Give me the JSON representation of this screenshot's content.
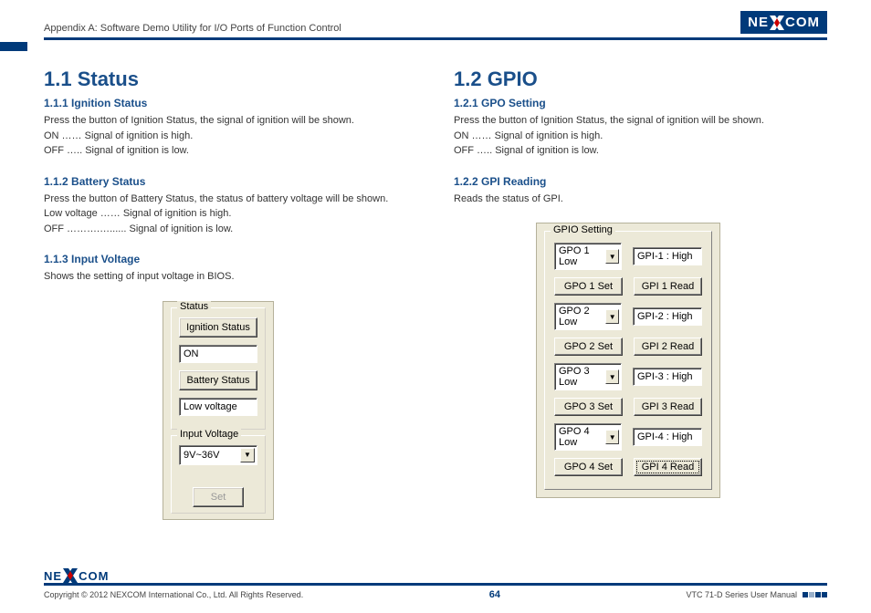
{
  "header": {
    "title": "Appendix A: Software Demo Utility for I/O Ports of Function Control",
    "brand": "NEXCOM"
  },
  "left": {
    "h1": "1.1  Status",
    "s1": {
      "h": "1.1.1  Ignition Status",
      "p": "Press the button of Ignition Status, the signal of ignition will be shown.\nON …… Signal of ignition is high.\nOFF ….. Signal of ignition is low."
    },
    "s2": {
      "h": "1.1.2  Battery Status",
      "p": "Press the button of Battery Status, the status of battery voltage will be shown.\nLow voltage …… Signal of ignition is high.\nOFF ……….…...... Signal of ignition is low."
    },
    "s3": {
      "h": "1.1.3  Input Voltage",
      "p": "Shows the setting of input voltage in BIOS."
    },
    "status_panel": {
      "legend": "Status",
      "btn_ign": "Ignition Status",
      "val_ign": "ON",
      "btn_bat": "Battery Status",
      "val_bat": "Low voltage"
    },
    "iv_panel": {
      "legend": "Input Voltage",
      "dd": "9V~36V",
      "btn_set": "Set"
    }
  },
  "right": {
    "h1": "1.2  GPIO",
    "s1": {
      "h": "1.2.1  GPO Setting",
      "p": "Press the button of Ignition Status, the signal of ignition will be shown.\nON …… Signal of ignition is high.\nOFF ….. Signal of ignition is low."
    },
    "s2": {
      "h": "1.2.2  GPI Reading",
      "p": "Reads the status of GPI."
    },
    "gpio": {
      "legend": "GPIO Setting",
      "rows": [
        {
          "dd": "GPO 1 Low",
          "gpi": "GPI-1 : High",
          "set": "GPO 1 Set",
          "read": "GPI 1 Read"
        },
        {
          "dd": "GPO 2 Low",
          "gpi": "GPI-2 : High",
          "set": "GPO 2 Set",
          "read": "GPI 2 Read"
        },
        {
          "dd": "GPO 3 Low",
          "gpi": "GPI-3 : High",
          "set": "GPO 3 Set",
          "read": "GPI 3 Read"
        },
        {
          "dd": "GPO 4 Low",
          "gpi": "GPI-4 : High",
          "set": "GPO 4 Set",
          "read": "GPI 4 Read"
        }
      ]
    }
  },
  "footer": {
    "copyright": "Copyright © 2012 NEXCOM International Co., Ltd. All Rights Reserved.",
    "page": "64",
    "manual": "VTC 71-D Series User Manual"
  }
}
